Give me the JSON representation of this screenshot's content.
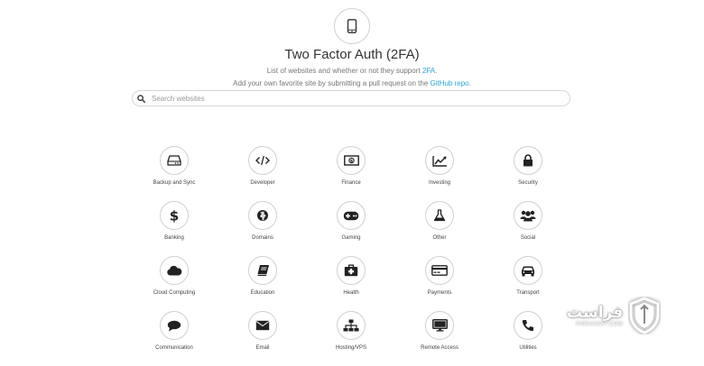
{
  "header": {
    "logo_icon": "mobile-phone-icon",
    "title": "Two Factor Auth (2FA)",
    "subtitle_prefix": "List of websites and whether or not they support ",
    "subtitle_link": "2FA",
    "subtitle_suffix": ".",
    "contrib_prefix": "Add your own favorite site by submitting a pull request on the ",
    "contrib_link": "GitHub repo",
    "contrib_suffix": ".",
    "link_color": "#2aa7d8"
  },
  "search": {
    "placeholder": "Search websites",
    "value": "",
    "icon": "search-icon"
  },
  "categories": [
    {
      "label": "Backup and Sync",
      "icon": "hard-drive-icon"
    },
    {
      "label": "Developer",
      "icon": "code-icon"
    },
    {
      "label": "Finance",
      "icon": "money-icon"
    },
    {
      "label": "Investing",
      "icon": "line-chart-icon"
    },
    {
      "label": "Security",
      "icon": "lock-icon"
    },
    {
      "label": "Banking",
      "icon": "dollar-icon"
    },
    {
      "label": "Domains",
      "icon": "globe-icon"
    },
    {
      "label": "Gaming",
      "icon": "gamepad-icon"
    },
    {
      "label": "Other",
      "icon": "flask-icon"
    },
    {
      "label": "Social",
      "icon": "users-icon"
    },
    {
      "label": "Cloud Computing",
      "icon": "cloud-icon"
    },
    {
      "label": "Education",
      "icon": "book-icon"
    },
    {
      "label": "Health",
      "icon": "medkit-icon"
    },
    {
      "label": "Payments",
      "icon": "credit-card-icon"
    },
    {
      "label": "Transport",
      "icon": "car-icon"
    },
    {
      "label": "Communication",
      "icon": "comment-icon"
    },
    {
      "label": "Email",
      "icon": "envelope-icon"
    },
    {
      "label": "Hosting/VPS",
      "icon": "sitemap-icon"
    },
    {
      "label": "Remote Access",
      "icon": "desktop-icon"
    },
    {
      "label": "Utilities",
      "icon": "phone-icon"
    }
  ],
  "watermark": {
    "main_text": "فراست",
    "sub_text": "FARAASAT.COM",
    "icon": "shield-logo-icon"
  }
}
